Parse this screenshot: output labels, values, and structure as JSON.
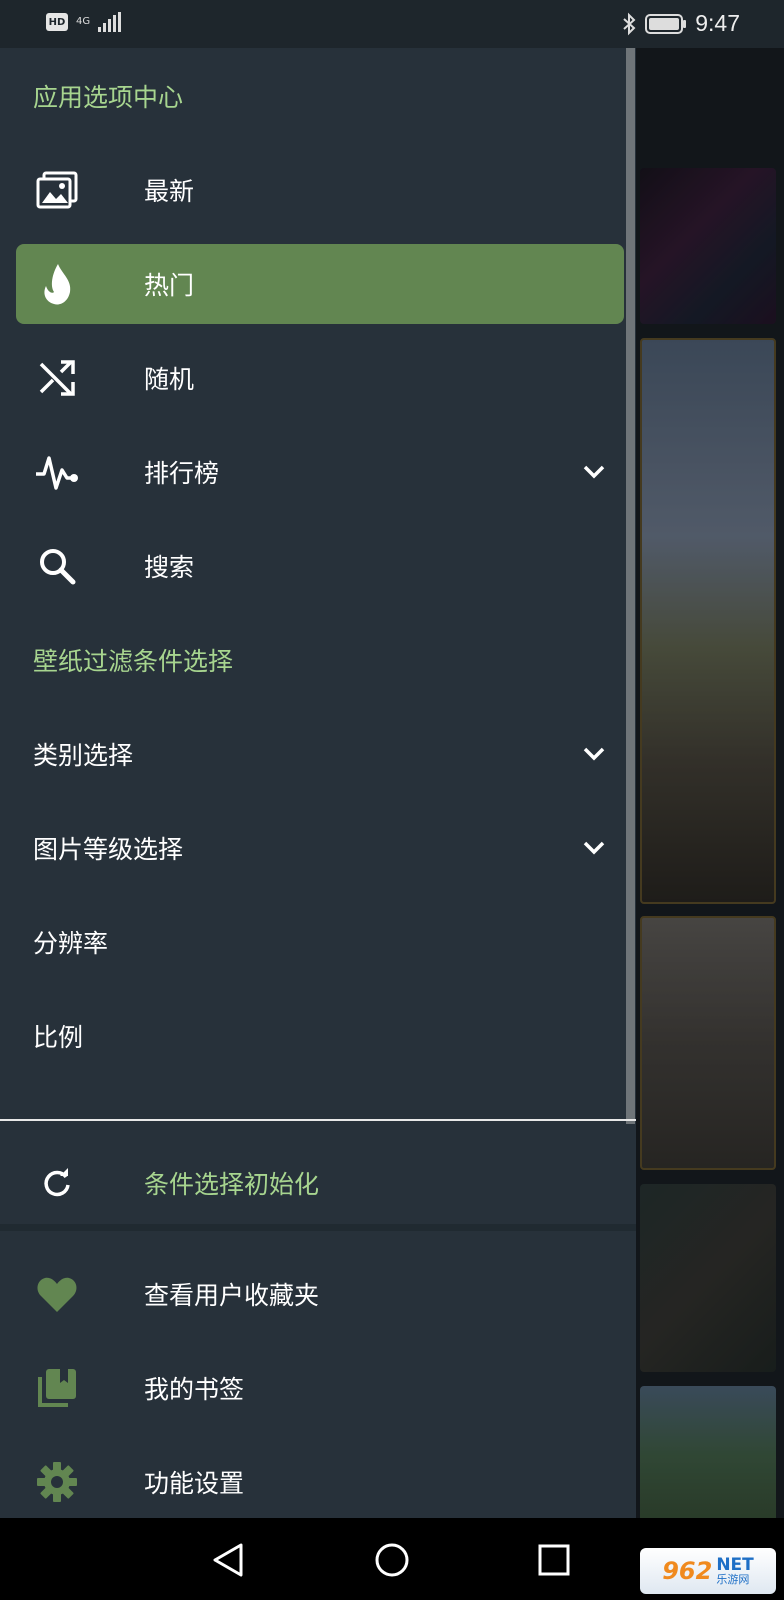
{
  "status_bar": {
    "signal_label": "4G",
    "time": "9:47"
  },
  "drawer": {
    "header_title": "应用选项中心",
    "nav_items": [
      {
        "label": "最新",
        "icon": "images-icon"
      },
      {
        "label": "热门",
        "icon": "flame-icon",
        "active": true
      },
      {
        "label": "随机",
        "icon": "shuffle-icon"
      },
      {
        "label": "排行榜",
        "icon": "pulse-icon",
        "expandable": true
      },
      {
        "label": "搜索",
        "icon": "search-icon"
      }
    ],
    "filter_title": "壁纸过滤条件选择",
    "filter_items": [
      {
        "label": "类别选择",
        "expandable": true
      },
      {
        "label": "图片等级选择",
        "expandable": true
      },
      {
        "label": "分辨率"
      },
      {
        "label": "比例"
      }
    ],
    "reset_label": "条件选择初始化",
    "bottom_items": [
      {
        "label": "查看用户收藏夹",
        "icon": "heart-icon"
      },
      {
        "label": "我的书签",
        "icon": "bookmarks-icon"
      },
      {
        "label": "功能设置",
        "icon": "gear-icon"
      }
    ]
  },
  "watermark": {
    "number": "962",
    "net": "NET",
    "site_name": "乐游网"
  },
  "colors": {
    "accent_green": "#a7d58f",
    "active_bg": "#628651",
    "drawer_bg": "#27313a",
    "icon_green": "#628651"
  }
}
